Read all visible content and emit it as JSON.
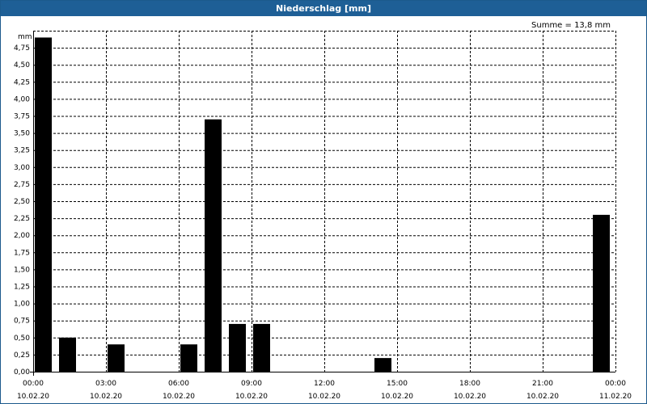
{
  "window": {
    "title": "Niederschlag [mm]"
  },
  "summary_text": "Summe = 13,8 mm",
  "chart_data": {
    "type": "bar",
    "title": "Niederschlag [mm]",
    "ylabel": "mm",
    "xlabel": "",
    "ylim": [
      0,
      5.0
    ],
    "y_ticks": [
      "0,00",
      "0,25",
      "0,50",
      "0,75",
      "1,00",
      "1,25",
      "1,50",
      "1,75",
      "2,00",
      "2,25",
      "2,50",
      "2,75",
      "3,00",
      "3,25",
      "3,50",
      "3,75",
      "4,00",
      "4,25",
      "4,50",
      "4,75"
    ],
    "x_hours_range": [
      0,
      24
    ],
    "x_ticks": [
      {
        "time": "00:00",
        "date": "10.02.20"
      },
      {
        "time": "03:00",
        "date": "10.02.20"
      },
      {
        "time": "06:00",
        "date": "10.02.20"
      },
      {
        "time": "09:00",
        "date": "10.02.20"
      },
      {
        "time": "12:00",
        "date": "10.02.20"
      },
      {
        "time": "15:00",
        "date": "10.02.20"
      },
      {
        "time": "18:00",
        "date": "10.02.20"
      },
      {
        "time": "21:00",
        "date": "10.02.20"
      },
      {
        "time": "00:00",
        "date": "11.02.20"
      }
    ],
    "bars": [
      {
        "hour": 0,
        "value": 4.9
      },
      {
        "hour": 1,
        "value": 0.5
      },
      {
        "hour": 3,
        "value": 0.4
      },
      {
        "hour": 6,
        "value": 0.4
      },
      {
        "hour": 7,
        "value": 3.7
      },
      {
        "hour": 8,
        "value": 0.7
      },
      {
        "hour": 9,
        "value": 0.7
      },
      {
        "hour": 14,
        "value": 0.2
      },
      {
        "hour": 23,
        "value": 2.3
      }
    ],
    "grid": true,
    "bar_color": "#000000"
  },
  "colors": {
    "title_bar": "#1e5f96",
    "title_text": "#ffffff",
    "grid": "#000000",
    "bars": "#000000"
  }
}
